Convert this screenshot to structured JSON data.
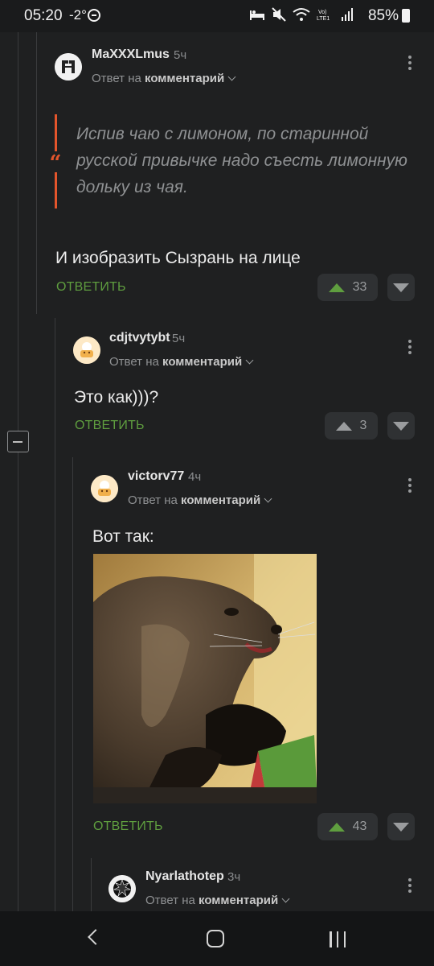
{
  "status_bar": {
    "time": "05:20",
    "weather": "-2°",
    "battery": "85%"
  },
  "comments": [
    {
      "username": "MaXXXLmus",
      "time": "5ч",
      "reply_prefix": "Ответ на",
      "reply_target": "комментарий",
      "quote": "Испив чаю с лимоном, по старинной русской привычке надо съесть лимонную дольку из чая.",
      "text": "И изобразить Сызрань на лице",
      "reply_label": "ОТВЕТИТЬ",
      "votes": "33"
    },
    {
      "username": "cdjtvytybt",
      "time": "5ч",
      "reply_prefix": "Ответ на",
      "reply_target": "комментарий",
      "text": "Это как)))?",
      "reply_label": "ОТВЕТИТЬ",
      "votes": "3"
    },
    {
      "username": "victorv77",
      "time": "4ч",
      "reply_prefix": "Ответ на",
      "reply_target": "комментарий",
      "text": "Вот так:",
      "reply_label": "ОТВЕТИТЬ",
      "votes": "43"
    },
    {
      "username": "Nyarlathotep",
      "time": "3ч",
      "reply_prefix": "Ответ на",
      "reply_target": "комментарий"
    }
  ],
  "colors": {
    "accent_green": "#5f9e3f",
    "quote_red": "#e3552c",
    "background": "#1f2021"
  },
  "icons": [
    "sync-icon",
    "sleep-mode-icon",
    "mute-icon",
    "wifi-icon",
    "volte-icon",
    "signal-icon",
    "battery-icon",
    "kebab-menu-icon",
    "chevron-down-icon",
    "upvote-icon",
    "downvote-icon",
    "quote-icon",
    "collapse-icon",
    "back-icon",
    "home-icon",
    "recents-icon"
  ]
}
